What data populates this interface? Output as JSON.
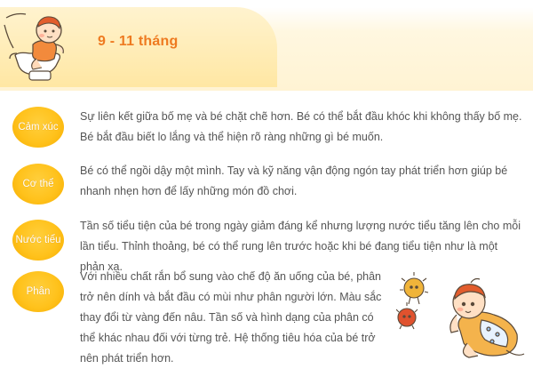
{
  "header": {
    "title": "9 - 11 tháng"
  },
  "sections": [
    {
      "label": "Cảm xúc",
      "text": "Sự liên kết giữa bố mẹ và bé chặt chẽ hơn. Bé có thể bắt đầu khóc khi không thấy bố mẹ. Bé bắt đầu biết lo lắng và thể hiện rõ ràng những gì bé muốn."
    },
    {
      "label": "Cơ thể",
      "text": "Bé có thể ngồi dậy một mình. Tay và kỹ năng vận động ngón tay phát triển hơn giúp bé nhanh nhẹn hơn để lấy những món đồ chơi."
    },
    {
      "label": "Nước tiểu",
      "text": "Tần số tiểu tiện của bé trong ngày giảm đáng kể nhưng lượng nước tiểu tăng lên cho mỗi lần tiểu. Thỉnh thoảng, bé có thể rung lên trước hoặc khi bé đang tiểu tiện như là một phản xạ."
    },
    {
      "label": "Phân",
      "text": "Với nhiều chất rắn bổ sung vào chế độ ăn uống của bé, phân trở nên dính và bắt đầu có mùi như phân người lớn. Màu sắc thay đổi từ vàng đến nâu. Tần số và hình dạng của phân có thể khác nhau đối với từng trẻ. Hệ thống tiêu hóa của bé trở nên phát triển hơn."
    }
  ],
  "colors": {
    "accent": "#ee7a20",
    "badge": "#ffc21c",
    "band": "#fff3d3",
    "body_text": "#555555"
  },
  "illustrations": [
    "baby-on-potty-illustration",
    "crawling-baby-illustration"
  ]
}
